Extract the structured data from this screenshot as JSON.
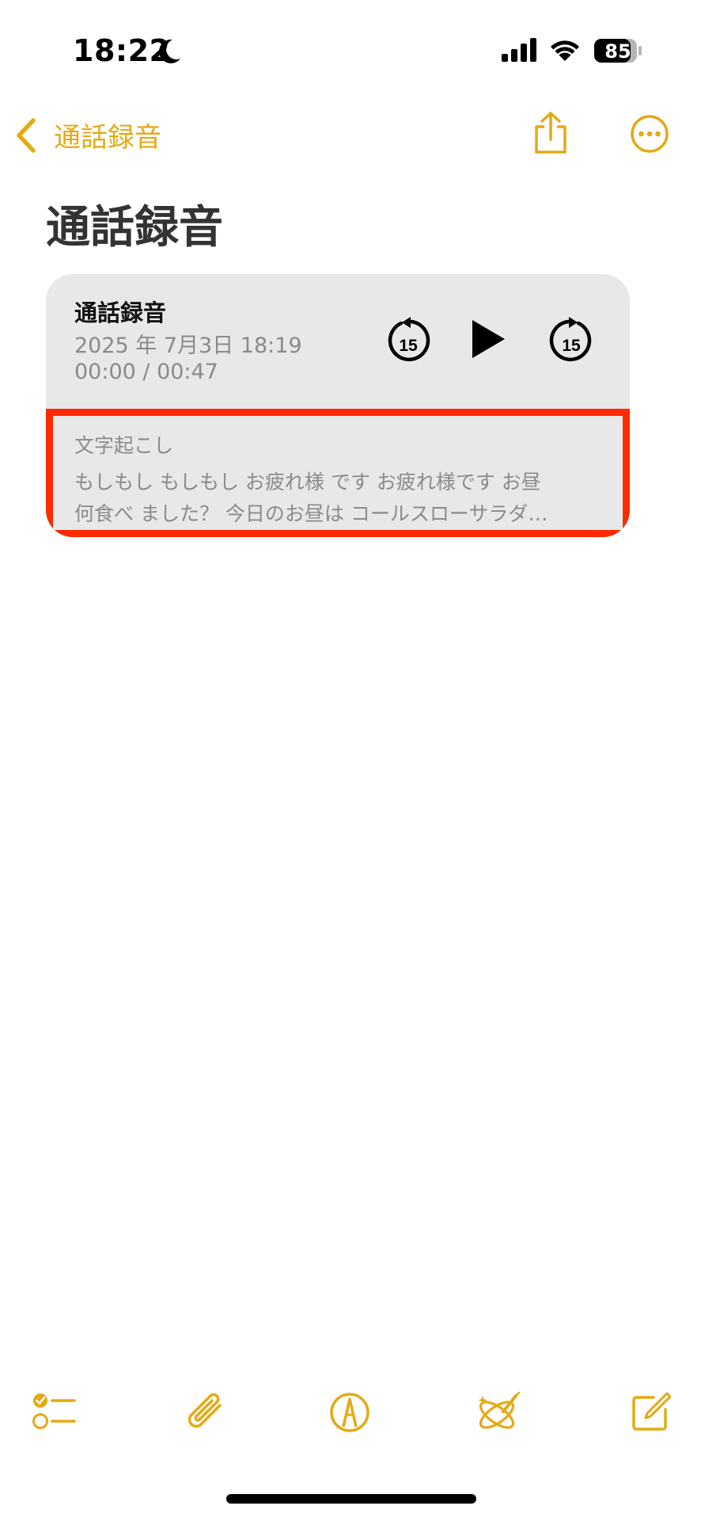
{
  "status_bar": {
    "time": "18:22",
    "battery": "85"
  },
  "nav": {
    "back_label": "通話録音",
    "accent_color": "#e5a914"
  },
  "page": {
    "title": "通話録音"
  },
  "recording": {
    "title": "通話録音",
    "date": "2025 年 7月3日 18:19",
    "time": "00:00 / 00:47",
    "skip_seconds": "15"
  },
  "transcript": {
    "label": "文字起こし",
    "line1": "もしもし もしもし お疲れ様 です お疲れ様です お昼",
    "line2": "何食べ ました？ 今日のお昼は コールスローサラダ…",
    "highlight_color": "#ff2a00"
  },
  "toolbar": {
    "icons": [
      "checklist-icon",
      "paperclip-icon",
      "markup-pen-icon",
      "writing-tools-icon",
      "compose-icon"
    ]
  }
}
